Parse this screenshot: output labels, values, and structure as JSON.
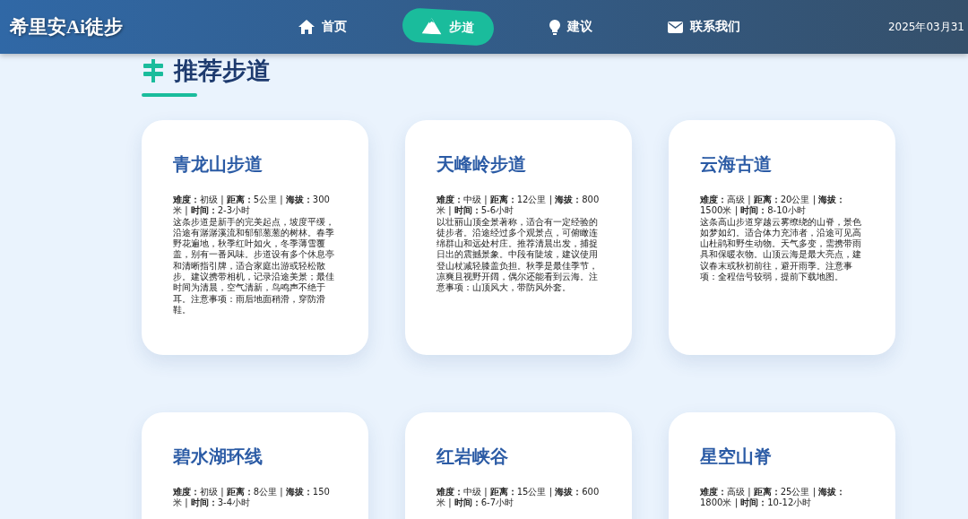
{
  "header": {
    "logo": "希里安Ai徒步",
    "nav": [
      {
        "label": "首页",
        "kind": "home",
        "selected": false
      },
      {
        "label": "步道",
        "kind": "trail",
        "selected": true
      },
      {
        "label": "建议",
        "kind": "tip",
        "selected": false
      },
      {
        "label": "联系我们",
        "kind": "contact",
        "selected": false
      }
    ],
    "date": "2025年03月31"
  },
  "section": {
    "title": "推荐步道"
  },
  "trails": [
    {
      "name": "青龙山步道",
      "meta": "**难度：**初级 | **距离：**5公里 | **海拔：**300米 | **时间：**2-3小时",
      "description": "这条步道是新手的完美起点，坡度平缓，沿途有潺潺溪流和郁郁葱葱的树林。春季野花遍地，秋季红叶如火，冬季薄雪覆盖，别有一番风味。步道设有多个休息亭和清晰指引牌，适合家庭出游或轻松散步。建议携带相机，记录沿途美景；最佳时间为清晨，空气清新，鸟鸣声不绝于耳。注意事项：雨后地面稍滑，穿防滑鞋。"
    },
    {
      "name": "天峰岭步道",
      "meta": "**难度：**中级 | **距离：**12公里 | **海拔：**800米 | **时间：**5-6小时",
      "description": "以壮丽山顶全景著称，适合有一定经验的徒步者。沿途经过多个观景点，可俯瞰连绵群山和远处村庄。推荐清晨出发，捕捉日出的震撼景象。中段有陡坡，建议使用登山杖减轻膝盖负担。秋季是最佳季节，凉爽且视野开阔，偶尔还能看到云海。注意事项：山顶风大，带防风外套。"
    },
    {
      "name": "云海古道",
      "meta": "**难度：**高级 | **距离：**20公里 | **海拔：**1500米 | **时间：**8-10小时",
      "description": "这条高山步道穿越云雾缭绕的山脊，景色如梦如幻。适合体力充沛者，沿途可见高山杜鹃和野生动物。天气多变，需携带雨具和保暖衣物。山顶云海是最大亮点，建议春末或秋初前往，避开雨季。注意事项：全程信号较弱，提前下载地图。"
    },
    {
      "name": "碧水湖环线",
      "meta": "**难度：**初级 | **距离：**8公里 | **海拔：**150米 | **时间：**3-4小时"
    },
    {
      "name": "红岩峡谷",
      "meta": "**难度：**中级 | **距离：**15公里 | **海拔：**600米 | **时间：**6-7小时"
    },
    {
      "name": "星空山脊",
      "meta": "**难度：**高级 | **距离：**25公里 | **海拔：**1800米 | **时间：**10-12小时"
    }
  ]
}
